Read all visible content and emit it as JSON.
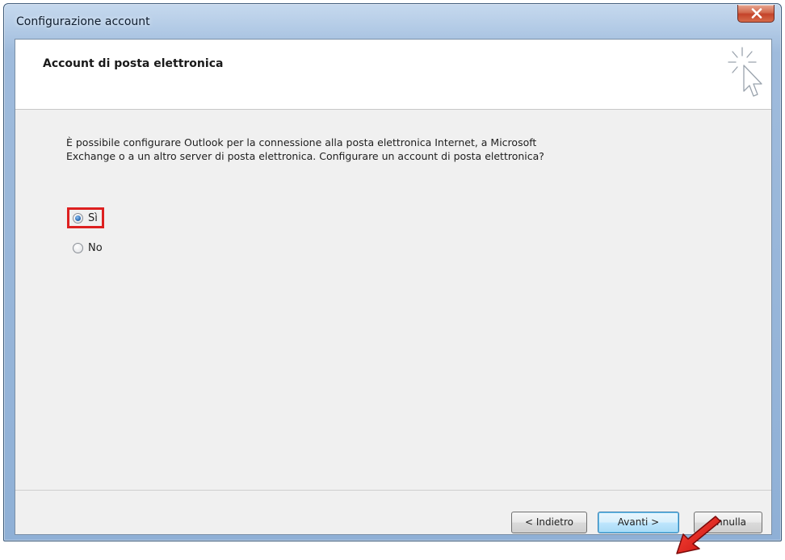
{
  "window": {
    "title": "Configurazione account",
    "close_label": "×"
  },
  "header": {
    "title": "Account di posta elettronica",
    "icon": "wizard-cursor-icon"
  },
  "content": {
    "description": "È possibile configurare Outlook per la connessione alla posta elettronica Internet, a Microsoft Exchange o a un altro server di posta elettronica. Configurare un account di posta elettronica?",
    "options": [
      {
        "label": "Sì",
        "selected": true
      },
      {
        "label": "No",
        "selected": false
      }
    ]
  },
  "footer": {
    "back_label": "< Indietro",
    "next_label": "Avanti >",
    "cancel_label": "Annulla"
  },
  "colors": {
    "highlight": "#dd2020",
    "arrow": "#dd2020",
    "accent": "#3c7fb1"
  }
}
